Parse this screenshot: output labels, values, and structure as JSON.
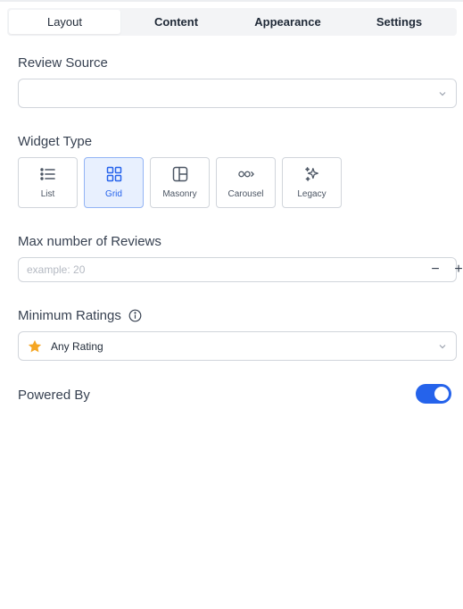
{
  "tabs": [
    {
      "label": "Layout",
      "active": true
    },
    {
      "label": "Content",
      "active": false
    },
    {
      "label": "Appearance",
      "active": false
    },
    {
      "label": "Settings",
      "active": false
    }
  ],
  "review_source": {
    "label": "Review Source",
    "value": "",
    "icon": "chevron-down-icon"
  },
  "widget_type": {
    "label": "Widget Type",
    "options": [
      {
        "label": "List",
        "icon": "list-icon",
        "selected": false
      },
      {
        "label": "Grid",
        "icon": "grid-icon",
        "selected": true
      },
      {
        "label": "Masonry",
        "icon": "masonry-icon",
        "selected": false
      },
      {
        "label": "Carousel",
        "icon": "carousel-icon",
        "selected": false
      },
      {
        "label": "Legacy",
        "icon": "sparkles-icon",
        "selected": false
      }
    ]
  },
  "max_reviews": {
    "label": "Max number of Reviews",
    "value": "",
    "placeholder": "example: 20",
    "decrement": "−",
    "increment": "+"
  },
  "minimum_ratings": {
    "label": "Minimum Ratings",
    "value": "Any Rating",
    "icon": "star-icon",
    "info_icon": "info-icon"
  },
  "powered_by": {
    "label": "Powered By",
    "enabled": true
  },
  "colors": {
    "accent": "#2563eb",
    "selected_bg": "#e8f0fe",
    "star": "#f5a623",
    "border": "#d1d5db"
  }
}
